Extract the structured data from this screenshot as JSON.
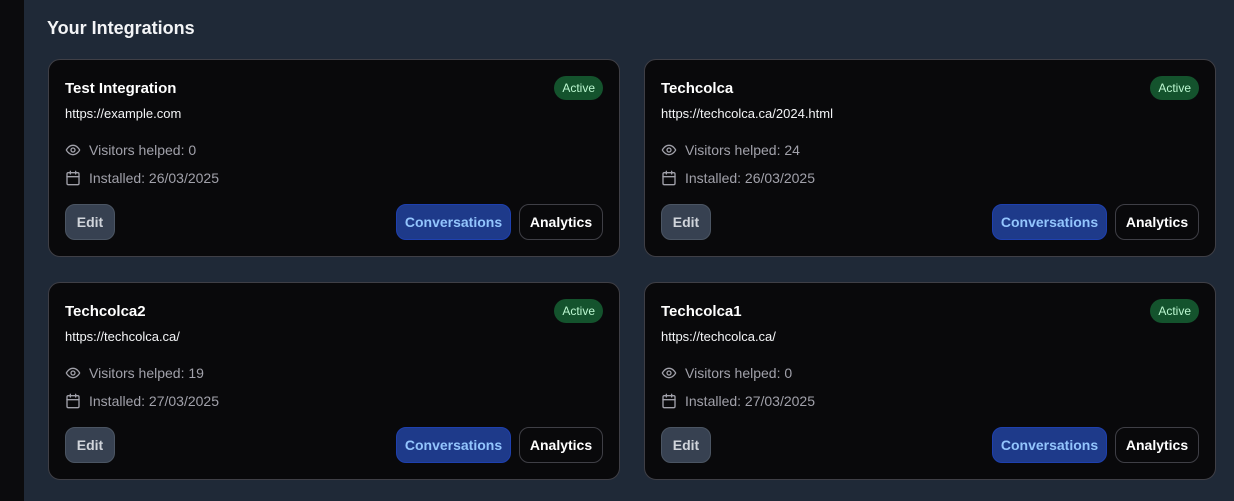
{
  "page": {
    "section_title": "Your Integrations"
  },
  "integrations": [
    {
      "name": "Test Integration",
      "status": "Active",
      "url": "https://example.com",
      "visitors": "Visitors helped: 0",
      "installed": "Installed: 26/03/2025",
      "edit_label": "Edit",
      "conversations_label": "Conversations",
      "analytics_label": "Analytics"
    },
    {
      "name": "Techcolca",
      "status": "Active",
      "url": "https://techcolca.ca/2024.html",
      "visitors": "Visitors helped: 24",
      "installed": "Installed: 26/03/2025",
      "edit_label": "Edit",
      "conversations_label": "Conversations",
      "analytics_label": "Analytics"
    },
    {
      "name": "Techcolca2",
      "status": "Active",
      "url": "https://techcolca.ca/",
      "visitors": "Visitors helped: 19",
      "installed": "Installed: 27/03/2025",
      "edit_label": "Edit",
      "conversations_label": "Conversations",
      "analytics_label": "Analytics"
    },
    {
      "name": "Techcolca1",
      "status": "Active",
      "url": "https://techcolca.ca/",
      "visitors": "Visitors helped: 0",
      "installed": "Installed: 27/03/2025",
      "edit_label": "Edit",
      "conversations_label": "Conversations",
      "analytics_label": "Analytics"
    }
  ],
  "icons": {
    "visitors": "eye-icon",
    "installed": "calendar-icon"
  },
  "colors": {
    "background": "#1f2937",
    "card": "#09090b",
    "active_badge": "#14532d",
    "conversations_button": "#1e3a8a"
  }
}
